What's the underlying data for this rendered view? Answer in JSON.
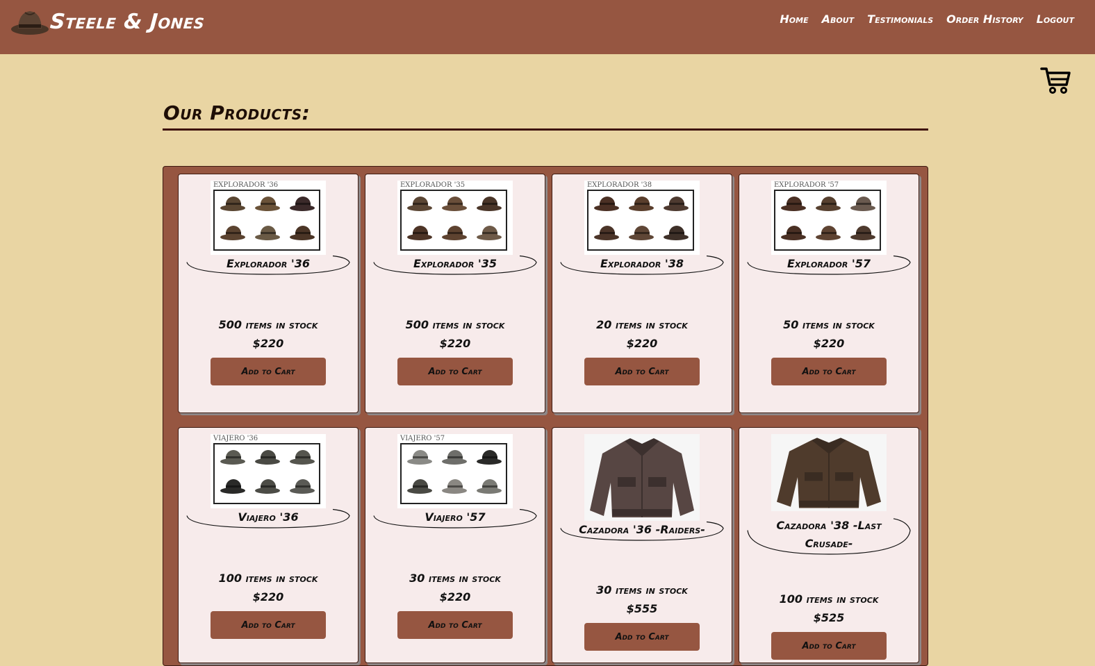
{
  "brand": {
    "name": "Steele & Jones"
  },
  "nav": [
    {
      "label": "Home"
    },
    {
      "label": "About"
    },
    {
      "label": "Testimonials"
    },
    {
      "label": "Order History"
    },
    {
      "label": "Logout"
    }
  ],
  "page": {
    "title": "Our Products:"
  },
  "colors": {
    "header": "#965641",
    "background": "#e9d5a3",
    "card": "#f7ebeb",
    "rule": "#3d0f0c"
  },
  "products": [
    {
      "name": "Explorador '36",
      "image_label": "EXPLORADOR '36",
      "stock": "500 items in stock",
      "price": "$220",
      "button": "Add to Cart",
      "image": "hats"
    },
    {
      "name": "Explorador '35",
      "image_label": "EXPLORADOR '35",
      "stock": "500 items in stock",
      "price": "$220",
      "button": "Add to Cart",
      "image": "hats"
    },
    {
      "name": "Explorador '38",
      "image_label": "EXPLORADOR '38",
      "stock": "20 items in stock",
      "price": "$220",
      "button": "Add to Cart",
      "image": "hats"
    },
    {
      "name": "Explorador '57",
      "image_label": "EXPLORADOR '57",
      "stock": "50 items in stock",
      "price": "$220",
      "button": "Add to Cart",
      "image": "hats"
    },
    {
      "name": "Viajero '36",
      "image_label": "VIAJERO '36",
      "stock": "100 items in stock",
      "price": "$220",
      "button": "Add to Cart",
      "image": "hats"
    },
    {
      "name": "Viajero '57",
      "image_label": "VIAJERO '57",
      "stock": "30 items in stock",
      "price": "$220",
      "button": "Add to Cart",
      "image": "hats"
    },
    {
      "name": "Cazadora '36 -Raiders-",
      "image_label": "",
      "stock": "30 items in stock",
      "price": "$555",
      "button": "Add to Cart",
      "image": "jacket"
    },
    {
      "name": "Cazadora '38 -Last Crusade-",
      "image_label": "",
      "stock": "100 items in stock",
      "price": "$525",
      "button": "Add to Cart",
      "image": "jacket"
    }
  ],
  "icons": {
    "logo": "fedora-hat-icon",
    "cart": "shopping-cart-icon"
  }
}
